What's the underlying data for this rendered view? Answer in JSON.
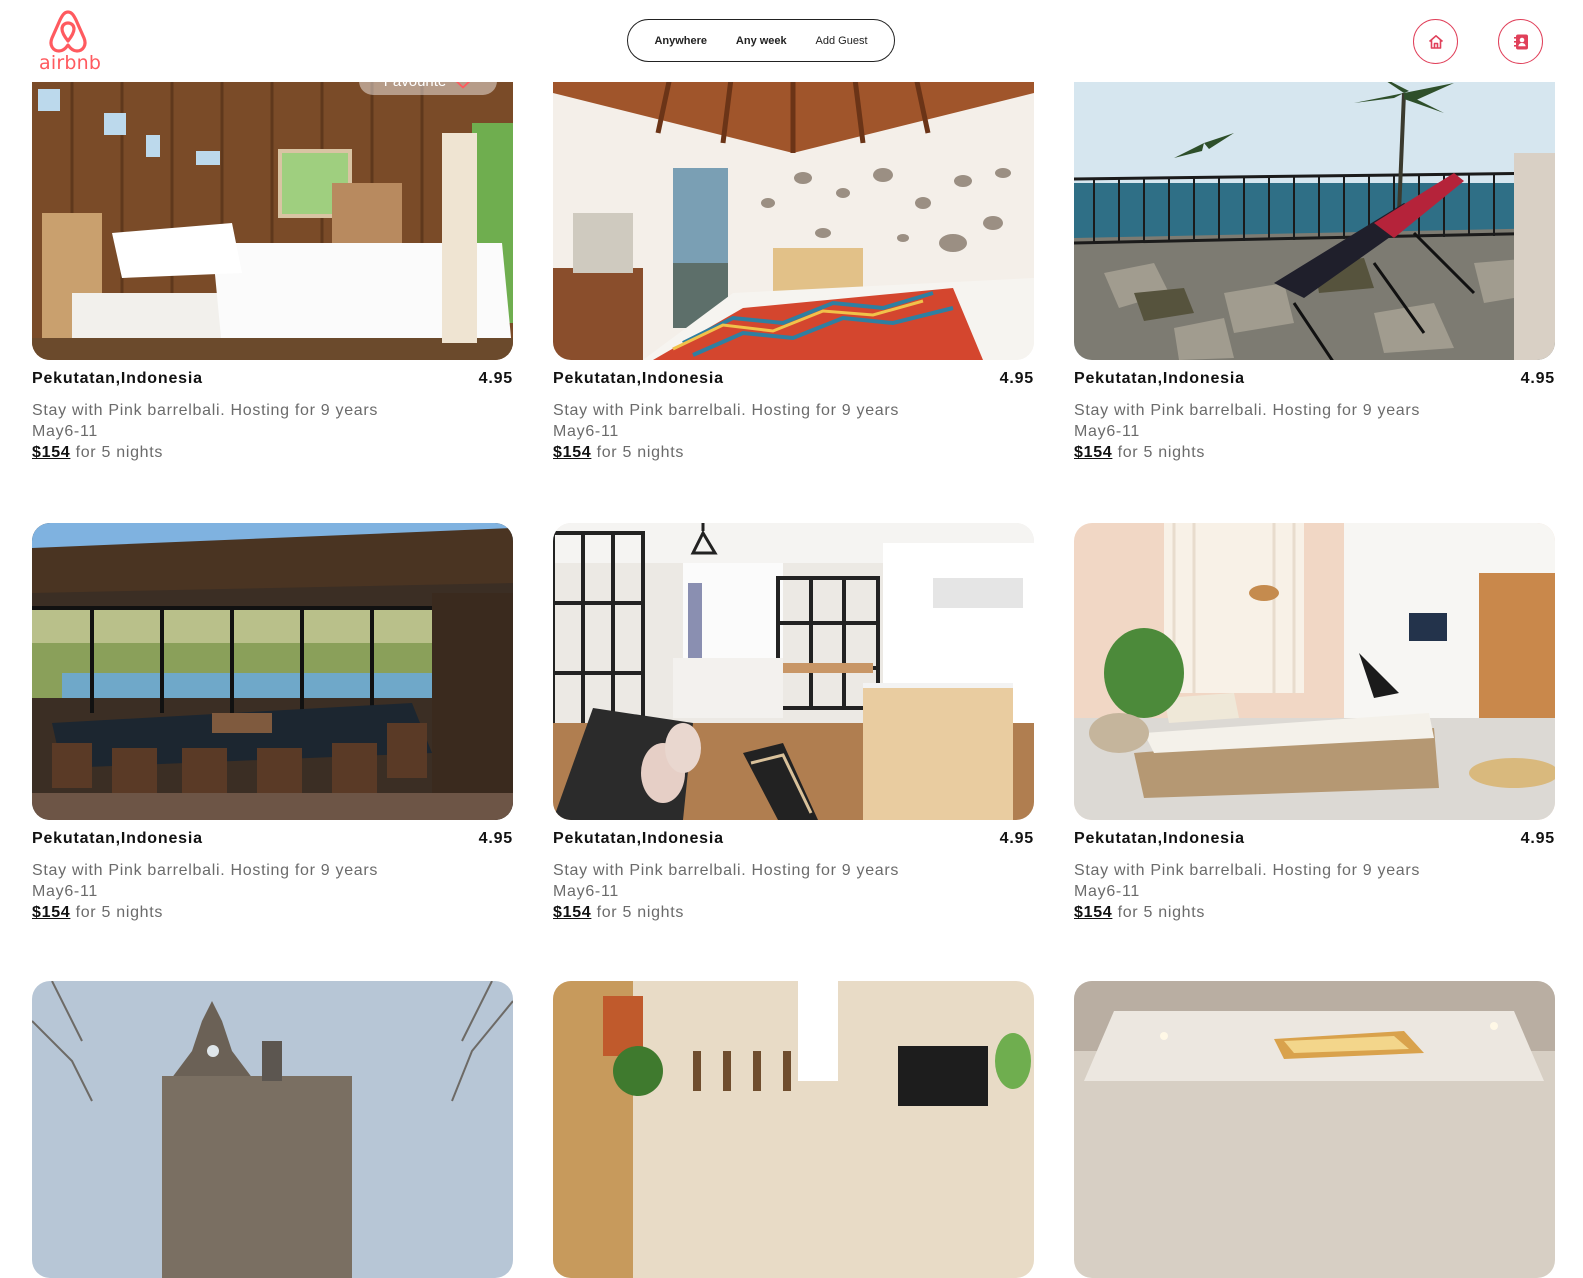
{
  "header": {
    "logo_text": "airbnb",
    "search": {
      "anywhere": "Anywhere",
      "any_week": "Any week",
      "add_guest": "Add Guest"
    }
  },
  "favourite_label": "Favourite",
  "listings": [
    {
      "location": "Pekutatan,Indonesia",
      "rating": "4.95",
      "description": "Stay with Pink barrelbali. Hosting for 9 years",
      "dates": "May6-11",
      "price": "$154",
      "price_suffix": "for 5 nights"
    },
    {
      "location": "Pekutatan,Indonesia",
      "rating": "4.95",
      "description": "Stay with Pink barrelbali. Hosting for 9 years",
      "dates": "May6-11",
      "price": "$154",
      "price_suffix": "for 5 nights"
    },
    {
      "location": "Pekutatan,Indonesia",
      "rating": "4.95",
      "description": "Stay with Pink barrelbali. Hosting for 9 years",
      "dates": "May6-11",
      "price": "$154",
      "price_suffix": "for 5 nights"
    },
    {
      "location": "Pekutatan,Indonesia",
      "rating": "4.95",
      "description": "Stay with Pink barrelbali. Hosting for 9 years",
      "dates": "May6-11",
      "price": "$154",
      "price_suffix": "for 5 nights"
    },
    {
      "location": "Pekutatan,Indonesia",
      "rating": "4.95",
      "description": "Stay with Pink barrelbali. Hosting for 9 years",
      "dates": "May6-11",
      "price": "$154",
      "price_suffix": "for 5 nights"
    },
    {
      "location": "Pekutatan,Indonesia",
      "rating": "4.95",
      "description": "Stay with Pink barrelbali. Hosting for 9 years",
      "dates": "May6-11",
      "price": "$154",
      "price_suffix": "for 5 nights"
    }
  ],
  "colors": {
    "brand": "#ff5a5f",
    "accent": "#e0405a"
  },
  "icons": {
    "home": "home-icon",
    "profile": "contact-book-icon",
    "favourite": "heart-icon"
  }
}
